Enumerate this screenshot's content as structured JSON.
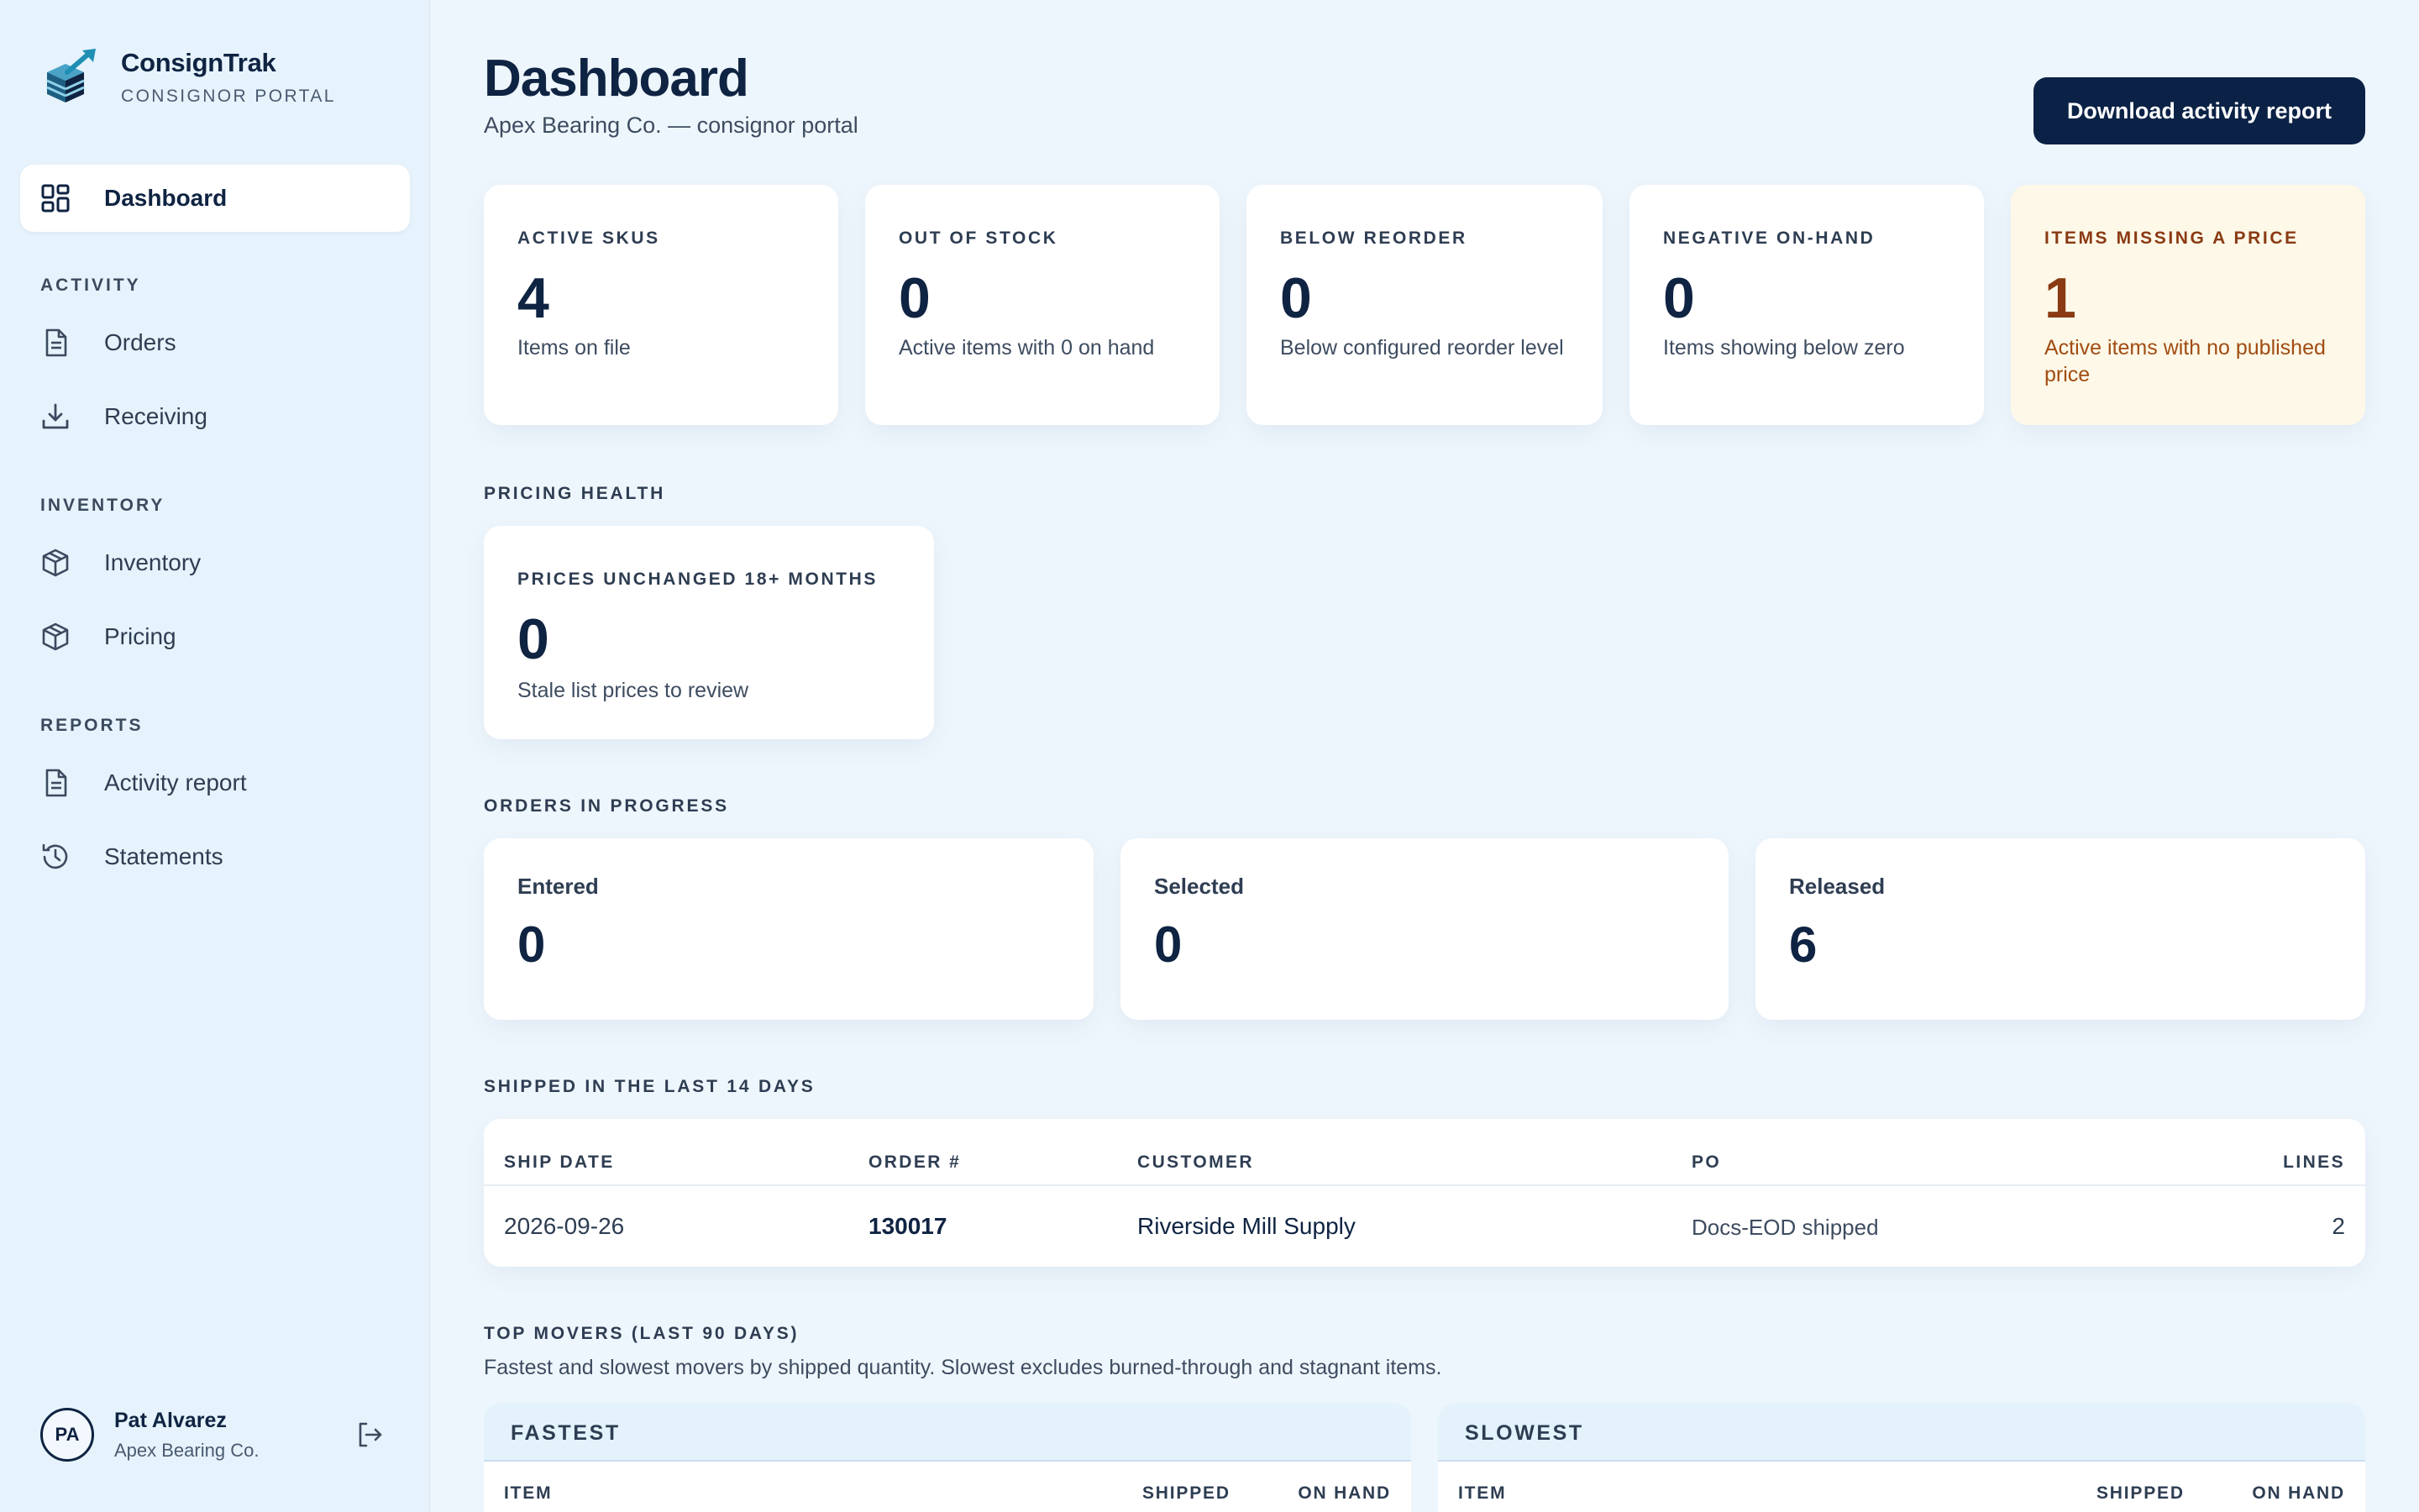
{
  "brand": {
    "name": "ConsignTrak",
    "subtitle": "CONSIGNOR PORTAL"
  },
  "nav": {
    "dashboard": "Dashboard",
    "sections": {
      "activity": "ACTIVITY",
      "inventory": "INVENTORY",
      "reports": "REPORTS"
    },
    "orders": "Orders",
    "receiving": "Receiving",
    "inventory": "Inventory",
    "pricing": "Pricing",
    "activity_report": "Activity report",
    "statements": "Statements"
  },
  "user": {
    "initials": "PA",
    "name": "Pat Alvarez",
    "org": "Apex Bearing Co."
  },
  "header": {
    "title": "Dashboard",
    "subtitle": "Apex Bearing Co. — consignor portal",
    "download_label": "Download activity report"
  },
  "kpis": [
    {
      "label": "ACTIVE SKUS",
      "value": "4",
      "desc": "Items on file"
    },
    {
      "label": "OUT OF STOCK",
      "value": "0",
      "desc": "Active items with 0 on hand"
    },
    {
      "label": "BELOW REORDER",
      "value": "0",
      "desc": "Below configured reorder level"
    },
    {
      "label": "NEGATIVE ON-HAND",
      "value": "0",
      "desc": "Items showing below zero"
    },
    {
      "label": "ITEMS MISSING A PRICE",
      "value": "1",
      "desc": "Active items with no published price"
    }
  ],
  "pricing_health": {
    "section": "PRICING HEALTH",
    "label": "PRICES UNCHANGED 18+ MONTHS",
    "value": "0",
    "desc": "Stale list prices to review"
  },
  "orders_progress": {
    "section": "ORDERS IN PROGRESS",
    "entered": {
      "label": "Entered",
      "value": "0"
    },
    "selected": {
      "label": "Selected",
      "value": "0"
    },
    "released": {
      "label": "Released",
      "value": "6"
    }
  },
  "shipped": {
    "section": "SHIPPED IN THE LAST 14 DAYS",
    "columns": {
      "ship_date": "SHIP DATE",
      "order": "ORDER #",
      "customer": "CUSTOMER",
      "po": "PO",
      "lines": "LINES"
    },
    "rows": [
      {
        "ship_date": "2026-09-26",
        "order": "130017",
        "customer": "Riverside Mill Supply",
        "po": "Docs-EOD shipped",
        "lines": "2"
      }
    ]
  },
  "movers": {
    "section": "TOP MOVERS (LAST 90 DAYS)",
    "desc": "Fastest and slowest movers by shipped quantity. Slowest excludes burned-through and stagnant items.",
    "fastest": {
      "title": "FASTEST",
      "col_item": "ITEM",
      "col_shipped": "SHIPPED",
      "col_onhand": "ON HAND"
    },
    "slowest": {
      "title": "SLOWEST",
      "col_item": "ITEM",
      "col_shipped": "SHIPPED",
      "col_onhand": "ON HAND"
    }
  },
  "colors": {
    "accent": "#0b2246",
    "warn_bg": "#fdf8e8",
    "warn_text": "#8a3a12",
    "sidebar_bg": "#e6f3fc",
    "page_bg": "#eef6fd"
  }
}
